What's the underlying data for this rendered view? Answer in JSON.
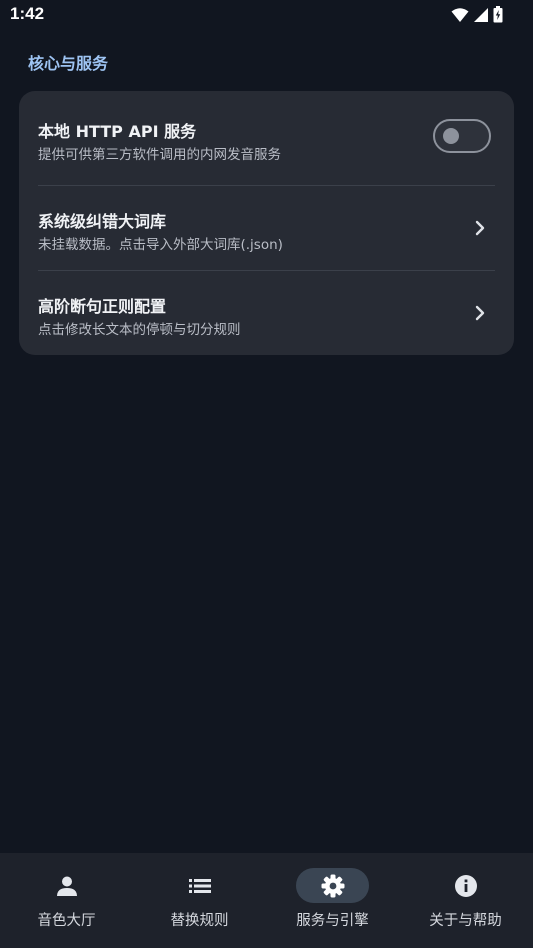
{
  "status_bar": {
    "time": "1:42"
  },
  "section": {
    "title": "核心与服务"
  },
  "settings": {
    "http_api": {
      "title": "本地 HTTP API 服务",
      "subtitle": "提供可供第三方软件调用的内网发音服务",
      "enabled": false
    },
    "dictionary": {
      "title": "系统级纠错大词库",
      "subtitle": "未挂载数据。点击导入外部大词库(.json)"
    },
    "regex": {
      "title": "高阶断句正则配置",
      "subtitle": "点击修改长文本的停顿与切分规则"
    }
  },
  "bottom_nav": {
    "items": [
      {
        "label": "音色大厅",
        "icon": "person-icon"
      },
      {
        "label": "替换规则",
        "icon": "list-icon"
      },
      {
        "label": "服务与引擎",
        "icon": "gear-icon"
      },
      {
        "label": "关于与帮助",
        "icon": "info-icon"
      }
    ],
    "active_index": 2
  },
  "colors": {
    "background": "#111620",
    "card": "#272b34",
    "accent": "#9ec4f3",
    "nav_background": "#1e222b",
    "nav_active_pill": "#3a4553"
  }
}
